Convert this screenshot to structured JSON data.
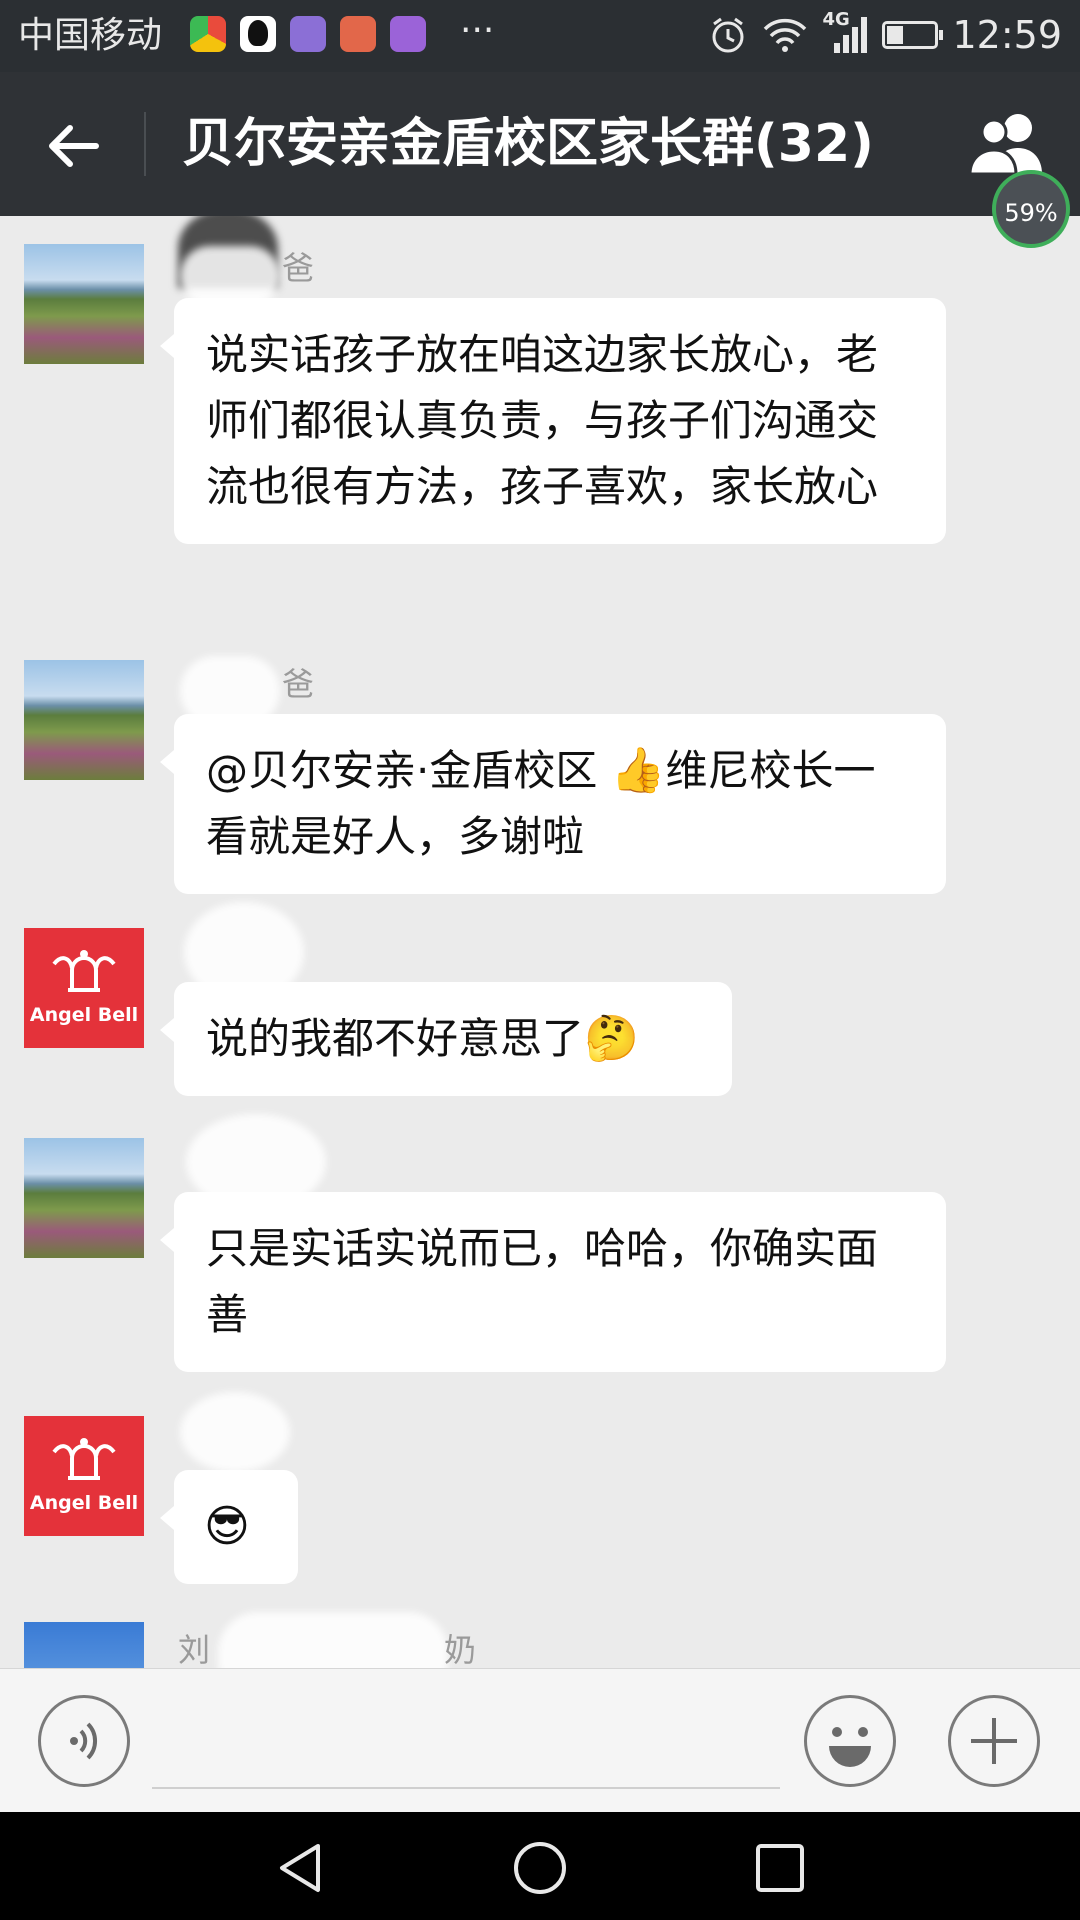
{
  "status_bar": {
    "carrier": "中国移动",
    "more": "···",
    "network": "4G",
    "time": "12:59",
    "battery_level": 0.35
  },
  "header": {
    "back_icon": "back-arrow-icon",
    "title": "贝尔安亲金盾校区家长群(32)",
    "members_icon": "group-members-icon"
  },
  "overlay": {
    "percent": "59%"
  },
  "messages": [
    {
      "sender": "爸",
      "avatar": "scenic",
      "text": "说实话孩子放在咱这边家长放心，老师们都很认真负责，与孩子们沟通交流也很有方法，孩子喜欢，家长放心"
    },
    {
      "sender": "爸",
      "avatar": "scenic",
      "text": "@贝尔安亲·金盾校区 ",
      "emoji": "👍",
      "text_after": "维尼校长一看就是好人，多谢啦"
    },
    {
      "sender": "",
      "avatar": "angelbell",
      "text": "说的我都不好意思了",
      "emoji": "🤔"
    },
    {
      "sender": "",
      "avatar": "scenic",
      "text": "只是实话实说而已，哈哈，你确实面善"
    },
    {
      "sender": "",
      "avatar": "angelbell",
      "text": "",
      "emoji": "😎"
    },
    {
      "sender": "刘",
      "sender_tail": "奶",
      "avatar": "blue"
    }
  ],
  "angelbell_label": "Angel Bell",
  "input_bar": {
    "voice_icon": "voice-icon",
    "emoji_icon": "emoji-icon",
    "plus_icon": "plus-icon"
  },
  "nav_bar": {
    "back": "nav-back-icon",
    "home": "nav-home-icon",
    "recent": "nav-recent-icon"
  }
}
